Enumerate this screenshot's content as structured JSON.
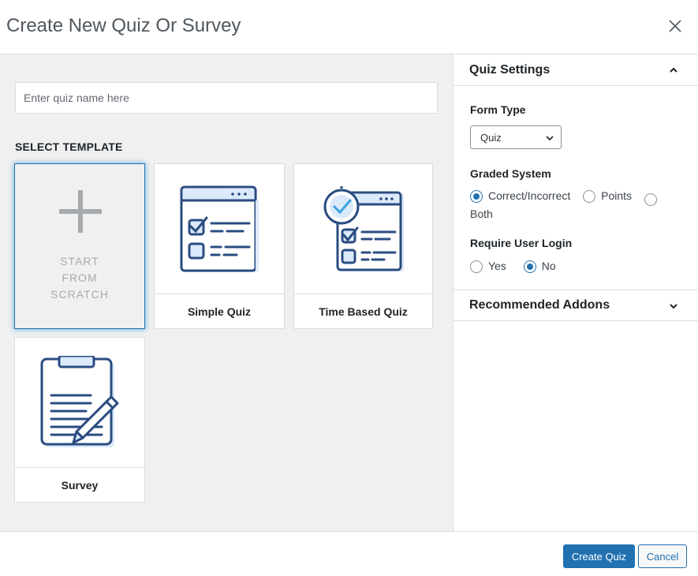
{
  "dialog": {
    "title": "Create New Quiz Or Survey",
    "close_icon": "close-icon"
  },
  "left": {
    "name_placeholder": "Enter quiz name here",
    "name_value": "",
    "section_label": "SELECT TEMPLATE",
    "templates": [
      {
        "id": "scratch",
        "label_lines": [
          "START",
          "FROM",
          "SCRATCH"
        ],
        "icon": "plus-icon",
        "selected": true
      },
      {
        "id": "simple-quiz",
        "label": "Simple Quiz",
        "icon": "quiz-window-icon"
      },
      {
        "id": "time-based-quiz",
        "label": "Time Based Quiz",
        "icon": "timed-quiz-icon"
      },
      {
        "id": "survey",
        "label": "Survey",
        "icon": "clipboard-pen-icon"
      }
    ]
  },
  "settings": {
    "title": "Quiz Settings",
    "form_type": {
      "label": "Form Type",
      "selected": "Quiz"
    },
    "graded_system": {
      "label": "Graded System",
      "options": [
        "Correct/Incorrect",
        "Points",
        "Both"
      ],
      "selected": "Correct/Incorrect"
    },
    "require_login": {
      "label": "Require User Login",
      "options": [
        "Yes",
        "No"
      ],
      "selected": "No"
    }
  },
  "addons": {
    "title": "Recommended Addons"
  },
  "footer": {
    "create_label": "Create Quiz",
    "cancel_label": "Cancel"
  },
  "colors": {
    "accent": "#2271b1",
    "icon_stroke": "#2a4c80",
    "icon_fill": "#dbeafb",
    "panel_bg": "#f0f0f1"
  }
}
